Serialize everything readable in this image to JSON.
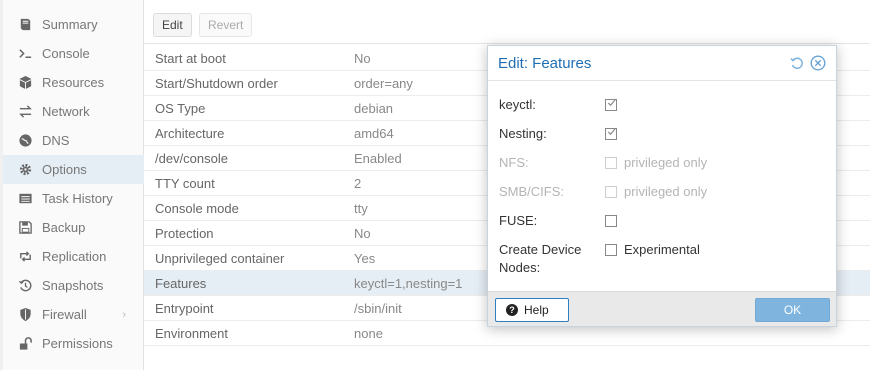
{
  "sidebar": {
    "items": [
      {
        "label": "Summary",
        "icon": "book-icon"
      },
      {
        "label": "Console",
        "icon": "terminal-icon"
      },
      {
        "label": "Resources",
        "icon": "cube-icon"
      },
      {
        "label": "Network",
        "icon": "exchange-icon"
      },
      {
        "label": "DNS",
        "icon": "globe-icon"
      },
      {
        "label": "Options",
        "icon": "gear-icon",
        "selected": true
      },
      {
        "label": "Task History",
        "icon": "list-icon"
      },
      {
        "label": "Backup",
        "icon": "floppy-icon"
      },
      {
        "label": "Replication",
        "icon": "retweet-icon"
      },
      {
        "label": "Snapshots",
        "icon": "history-icon"
      },
      {
        "label": "Firewall",
        "icon": "shield-icon",
        "expandable": true
      },
      {
        "label": "Permissions",
        "icon": "unlock-icon"
      }
    ]
  },
  "toolbar": {
    "edit_label": "Edit",
    "revert_label": "Revert"
  },
  "options": {
    "rows": [
      {
        "name": "Start at boot",
        "value": "No"
      },
      {
        "name": "Start/Shutdown order",
        "value": "order=any"
      },
      {
        "name": "OS Type",
        "value": "debian"
      },
      {
        "name": "Architecture",
        "value": "amd64"
      },
      {
        "name": "/dev/console",
        "value": "Enabled"
      },
      {
        "name": "TTY count",
        "value": "2"
      },
      {
        "name": "Console mode",
        "value": "tty"
      },
      {
        "name": "Protection",
        "value": "No"
      },
      {
        "name": "Unprivileged container",
        "value": "Yes"
      },
      {
        "name": "Features",
        "value": "keyctl=1,nesting=1",
        "selected": true
      },
      {
        "name": "Entrypoint",
        "value": "/sbin/init"
      },
      {
        "name": "Environment",
        "value": "none"
      }
    ]
  },
  "dialog": {
    "title": "Edit: Features",
    "fields": [
      {
        "label": "keyctl:",
        "checked": true,
        "disabled": false,
        "text": ""
      },
      {
        "label": "Nesting:",
        "checked": true,
        "disabled": false,
        "text": ""
      },
      {
        "label": "NFS:",
        "checked": false,
        "disabled": true,
        "text": "privileged only"
      },
      {
        "label": "SMB/CIFS:",
        "checked": false,
        "disabled": true,
        "text": "privileged only"
      },
      {
        "label": "FUSE:",
        "checked": false,
        "disabled": false,
        "text": ""
      },
      {
        "label_line1": "Create Device",
        "label_line2": "Nodes:",
        "checked": false,
        "disabled": false,
        "text": "Experimental"
      }
    ],
    "help_label": "Help",
    "ok_label": "OK"
  },
  "colors": {
    "accent": "#1f6eb3",
    "selected_row": "#e6eef5",
    "ok_button": "#7fb4de"
  }
}
